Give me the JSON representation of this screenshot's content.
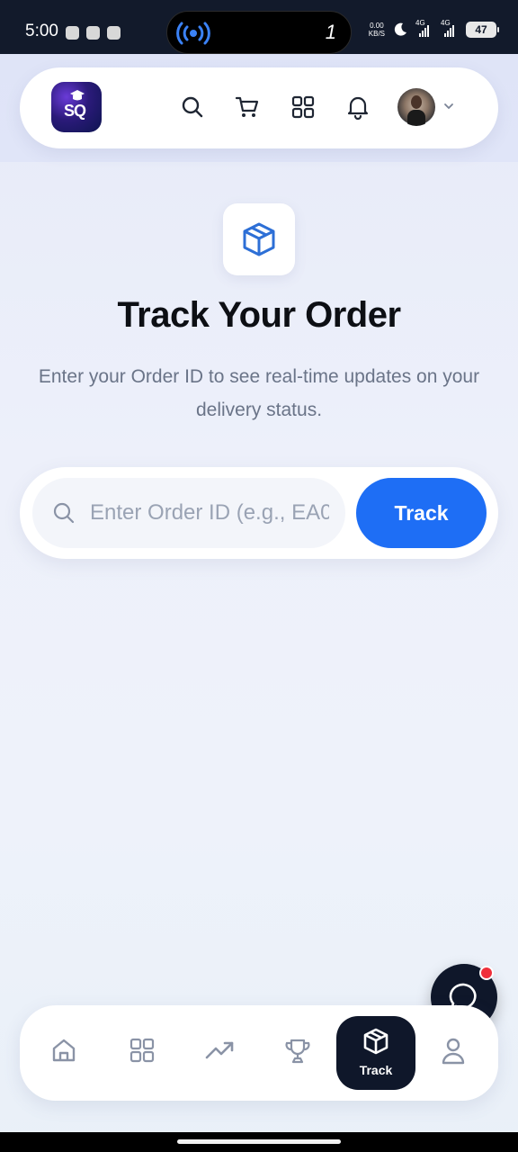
{
  "status_bar": {
    "time": "5:00",
    "island_number": "1",
    "speed_value": "0.00",
    "speed_unit": "KB/S",
    "network_1": "4G",
    "network_2": "4G",
    "battery": "47"
  },
  "header": {
    "logo_text": "SQ",
    "icons": [
      "search-icon",
      "cart-icon",
      "grid-icon",
      "bell-icon"
    ],
    "profile_menu": "chevron-down-icon"
  },
  "hero": {
    "icon": "package-icon",
    "title": "Track Your Order",
    "subtitle": "Enter your Order ID to see real-time updates on your delivery status."
  },
  "search": {
    "placeholder": "Enter Order ID (e.g., EA0",
    "value": "",
    "button_label": "Track"
  },
  "bottom_nav": {
    "items": [
      {
        "icon": "home-icon",
        "label": ""
      },
      {
        "icon": "grid-icon",
        "label": ""
      },
      {
        "icon": "trending-up-icon",
        "label": ""
      },
      {
        "icon": "trophy-icon",
        "label": ""
      },
      {
        "icon": "package-icon",
        "label": "Track",
        "active": true
      },
      {
        "icon": "user-icon",
        "label": ""
      }
    ]
  },
  "chat": {
    "icon": "chat-bubble-icon",
    "has_notification": true
  },
  "colors": {
    "primary": "#1e6ef5",
    "dark": "#0f172a",
    "notification": "#ef2f3a",
    "accent_icon": "#2d6fd6"
  }
}
